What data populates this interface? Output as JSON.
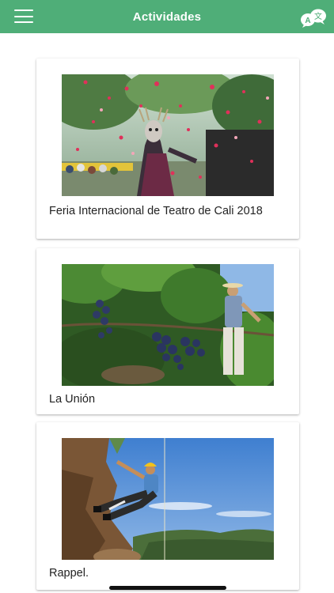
{
  "header": {
    "title": "Actividades",
    "menu_icon": "hamburger-menu-icon",
    "translate_icon": "translate-icon",
    "badge_letters": "A",
    "badge_glyph": "文"
  },
  "colors": {
    "appbar": "#4fae78",
    "card_bg": "#ffffff",
    "caption": "#222222"
  },
  "activities": [
    {
      "title": "Feria Internacional de Teatro de Cali 2018",
      "image": "theater-performance-photo"
    },
    {
      "title": "La Unión",
      "image": "vineyard-grapes-photo"
    },
    {
      "title": "Rappel.",
      "image": "rappel-climber-photo"
    }
  ]
}
